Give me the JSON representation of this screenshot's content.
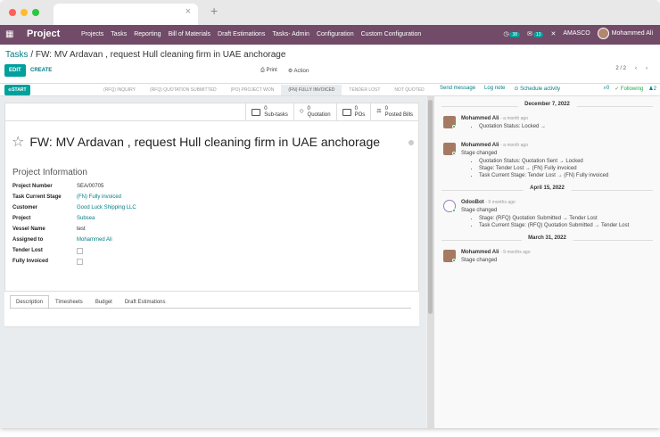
{
  "nav": {
    "brand": "Project",
    "menu": [
      "Projects",
      "Tasks",
      "Reporting",
      "Bill of Materials",
      "Draft Estimations",
      "Tasks- Admin",
      "Configuration",
      "Custom Configuration"
    ],
    "activity_count": "38",
    "message_count": "13",
    "company": "AMASCO",
    "user": "Mohammed Ali"
  },
  "breadcrumb": {
    "parent": "Tasks",
    "current": "FW: MV Ardavan , request Hull cleaning firm in UAE anchorage"
  },
  "toolbar": {
    "edit": "EDIT",
    "create": "CREATE",
    "print": "Print",
    "action": "Action",
    "pager": "2 / 2"
  },
  "statusbar": {
    "start": "START",
    "stages": [
      "(RFQ) INQUIRY",
      "(RFQ) QUOTATION SUBMITTED",
      "(PO) PROJECT WON",
      "(FN) FULLY INVOICED",
      "TENDER LOST",
      "NOT QUOTED"
    ],
    "active_stage": "(FN) FULLY INVOICED"
  },
  "chatter_actions": {
    "send": "Send message",
    "log": "Log note",
    "schedule": "Schedule activity",
    "attachments": "0",
    "following": "Following",
    "followers": "2"
  },
  "smart_buttons": [
    {
      "count": "0",
      "label": "Sub-tasks"
    },
    {
      "count": "0",
      "label": "Quotation"
    },
    {
      "count": "0",
      "label": "POs"
    },
    {
      "count": "0",
      "label": "Posted Bills"
    }
  ],
  "form": {
    "title": "FW: MV Ardavan , request Hull cleaning firm in UAE anchorage",
    "section": "Project Information",
    "fields": {
      "project_number": {
        "label": "Project Number",
        "value": "SEA/00705"
      },
      "stage": {
        "label": "Task Current Stage",
        "value": "(FN) Fully invoiced"
      },
      "customer": {
        "label": "Customer",
        "value": "Good Luck Shipping LLC"
      },
      "project": {
        "label": "Project",
        "value": "Subsea"
      },
      "vessel": {
        "label": "Vessel Name",
        "value": "test"
      },
      "assigned": {
        "label": "Assigned to",
        "value": "Mohammed Ali"
      },
      "tender_lost": {
        "label": "Tender Lost"
      },
      "fully_invoiced": {
        "label": "Fully Invoiced"
      }
    },
    "tabs": [
      "Description",
      "Timesheets",
      "Budget",
      "Draft Estimations"
    ]
  },
  "chatter": {
    "dates": [
      "December 7, 2022",
      "April 15, 2022",
      "March 31, 2022"
    ],
    "messages": [
      {
        "author": "Mohammed Ali",
        "when": "- a month ago",
        "lines": [
          "Quotation Status: Locked →"
        ]
      },
      {
        "author": "Mohammed Ali",
        "when": "- a month ago",
        "body": "Stage changed",
        "lines": [
          "Quotation Status: Quotation Sent → Locked",
          "Stage: Tender Lost → (FN) Fully invoiced",
          "Task Current Stage: Tender Lost → (FN) Fully invoiced"
        ]
      },
      {
        "author": "OdooBot",
        "when": "- 9 months ago",
        "body": "Stage changed",
        "lines": [
          "Stage: (RFQ) Quotation Submitted → Tender Lost",
          "Task Current Stage: (RFQ) Quotation Submitted → Tender Lost"
        ]
      },
      {
        "author": "Mohammed Ali",
        "when": "- 9 months ago",
        "body": "Stage changed"
      }
    ]
  }
}
